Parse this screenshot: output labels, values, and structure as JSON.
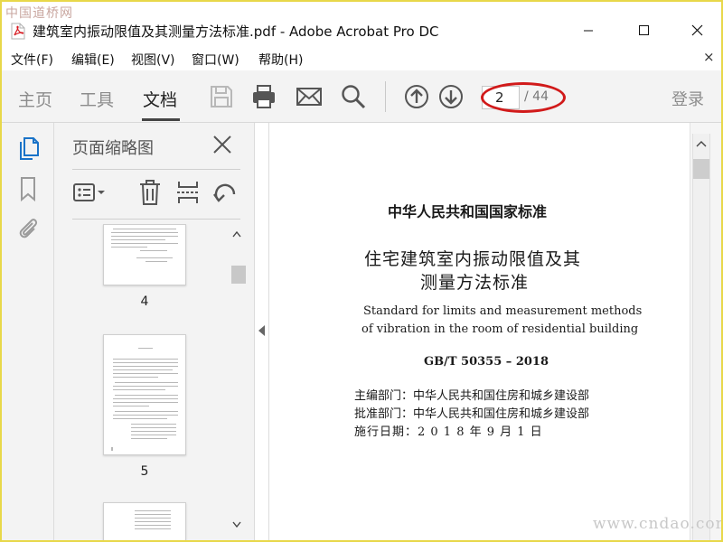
{
  "watermark": {
    "top": "中国道桥网",
    "bottom": "www.cndao.com"
  },
  "window": {
    "title": "建筑室内振动限值及其测量方法标准.pdf - Adobe Acrobat Pro DC"
  },
  "menu": {
    "items": [
      {
        "label": "文件(F)"
      },
      {
        "label": "编辑(E)"
      },
      {
        "label": "视图(V)"
      },
      {
        "label": "窗口(W)"
      },
      {
        "label": "帮助(H)"
      }
    ],
    "close_glyph": "×"
  },
  "toolbar": {
    "tabs": [
      {
        "label": "主页",
        "active": false
      },
      {
        "label": "工具",
        "active": false
      },
      {
        "label": "文档",
        "active": true
      }
    ],
    "icons": [
      "save-icon",
      "print-icon",
      "email-icon",
      "search-icon",
      "previous-page-icon",
      "next-page-icon"
    ],
    "page": {
      "current": "2",
      "total": "/ 44"
    },
    "login_label": "登录",
    "highlight_color": "#d11a1a"
  },
  "rail": {
    "icons": [
      "page-thumbnails-icon",
      "bookmark-icon",
      "attachment-icon"
    ],
    "accent": "#1a73c8"
  },
  "thumbnails_panel": {
    "title": "页面缩略图",
    "tools": [
      "options-menu-icon",
      "delete-page-icon",
      "extract-page-icon",
      "rotate-page-icon"
    ],
    "pages": [
      {
        "label": "4"
      },
      {
        "label": "5"
      }
    ]
  },
  "document": {
    "standard_type": "中华人民共和国国家标准",
    "title_line1": "住宅建筑室内振动限值及其",
    "title_line2": "测量方法标准",
    "english_line1": "Standard for limits and measurement methods",
    "english_line2": "of vibration in the room of residential building",
    "code": "GB/T 50355 – 2018",
    "info": [
      "主编部门：中华人民共和国住房和城乡建设部",
      "批准部门：中华人民共和国住房和城乡建设部",
      "施行日期：2 0 1 8 年 9 月 1 日"
    ]
  }
}
